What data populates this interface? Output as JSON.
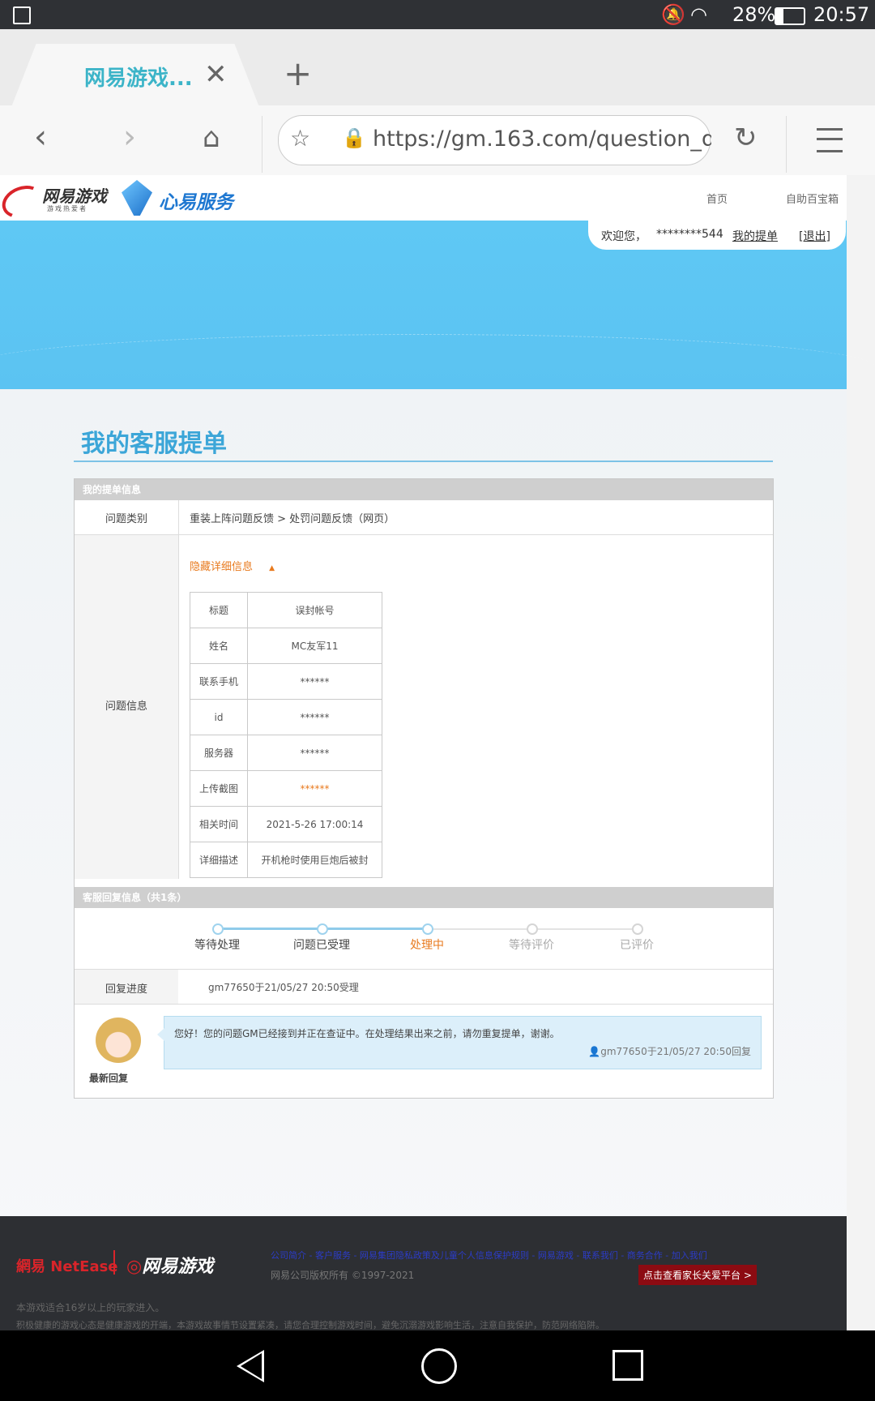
{
  "status_bar": {
    "battery": "28%",
    "time": "20:57"
  },
  "browser": {
    "tab_title": "网易游戏...",
    "url": "https://gm.163.com/question_deta"
  },
  "site": {
    "logo_netease_game": "网易游戏",
    "logo_sub": "游戏热爱者",
    "logo_service": "心易服务",
    "nav": [
      "首页",
      "自助百宝箱"
    ],
    "welcome": "欢迎您，",
    "username": "********544",
    "my_tickets": "我的提单",
    "logout": "[退出]"
  },
  "main": {
    "page_title": "我的客服提单",
    "section1_title": "我的提单信息",
    "category_label": "问题类别",
    "category_value": "重装上阵问题反馈 > 处罚问题反馈（网页）",
    "info_label": "问题信息",
    "toggle_label": "隐藏详细信息",
    "details": [
      {
        "k": "标题",
        "v": "误封帐号"
      },
      {
        "k": "姓名",
        "v": "MC友军11"
      },
      {
        "k": "联系手机",
        "v": "******"
      },
      {
        "k": "id",
        "v": "******"
      },
      {
        "k": "服务器",
        "v": "******"
      },
      {
        "k": "上传截图",
        "v": "******"
      },
      {
        "k": "相关时间",
        "v": "2021-5-26 17:00:14"
      },
      {
        "k": "详细描述",
        "v": "开机枪时使用巨炮后被封"
      }
    ],
    "section2_title": "客服回复信息（共1条）",
    "steps": [
      "等待处理",
      "问题已受理",
      "处理中",
      "等待评价",
      "已评价"
    ],
    "current_step": 2,
    "progress_label": "回复进度",
    "progress_value": "gm77650于21/05/27 20:50受理",
    "latest_reply_label": "最新回复",
    "reply_text": "您好！您的问题GM已经接到并正在查证中。在处理结果出来之前，请勿重复提单，谢谢。",
    "reply_meta": "gm77650于21/05/27 20:50回复"
  },
  "footer": {
    "netease_logo": "網易 NetEase",
    "game_logo": "网易游戏",
    "links": "公司简介 - 客户服务 - 网易集团隐私政策及儿童个人信息保护规则 - 网易游戏 - 联系我们 - 商务合作 - 加入我们",
    "copyright": "网易公司版权所有 ©1997-2021",
    "parent_btn": "点击查看家长关爱平台 >",
    "age_note": "本游戏适合16岁以上的玩家进入。",
    "health_note": "积极健康的游戏心态是健康游戏的开端，本游戏故事情节设置紧凑，请您合理控制游戏时间，避免沉溺游戏影响生活，注意自我保护，防范网络陷阱。"
  },
  "colors": {
    "accent": "#3ca6d8",
    "orange": "#e87a1e",
    "banner": "#5bc3f2"
  }
}
